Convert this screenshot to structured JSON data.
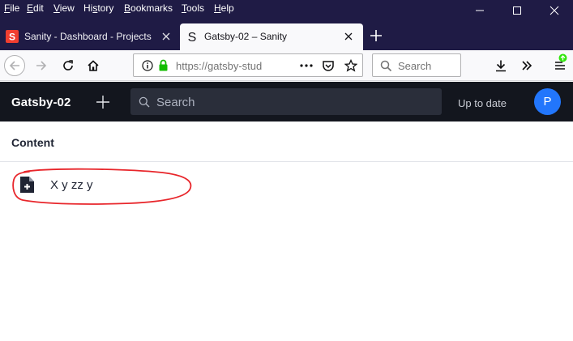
{
  "menu": {
    "items": [
      {
        "label": "File",
        "underline": "F"
      },
      {
        "label": "Edit",
        "underline": "E"
      },
      {
        "label": "View",
        "underline": "V"
      },
      {
        "label": "History",
        "underline": "s"
      },
      {
        "label": "Bookmarks",
        "underline": "B"
      },
      {
        "label": "Tools",
        "underline": "T"
      },
      {
        "label": "Help",
        "underline": "H"
      }
    ]
  },
  "window_controls": {
    "minimize": "minimize-icon",
    "maximize": "maximize-icon",
    "close": "close-icon"
  },
  "tabs": [
    {
      "title": "Sanity - Dashboard - Projects",
      "icon": "sanity-favicon",
      "active": false
    },
    {
      "title": "Gatsby-02 – Sanity",
      "icon": "sanity-s-favicon",
      "active": true
    }
  ],
  "navbar": {
    "url": "https://gatsby-stud",
    "search_placeholder": "Search"
  },
  "studio": {
    "project_name": "Gatsby-02",
    "search_placeholder": "Search",
    "status": "Up to date",
    "avatar_initial": "P",
    "avatar_color": "#2276fc"
  },
  "content": {
    "pane_title": "Content",
    "documents": [
      {
        "label": "X y zz y",
        "icon": "document-add-icon"
      }
    ]
  },
  "colors": {
    "titlebar": "#1f1b45",
    "studio_header": "#13161e",
    "annotation": "#e8262b"
  }
}
